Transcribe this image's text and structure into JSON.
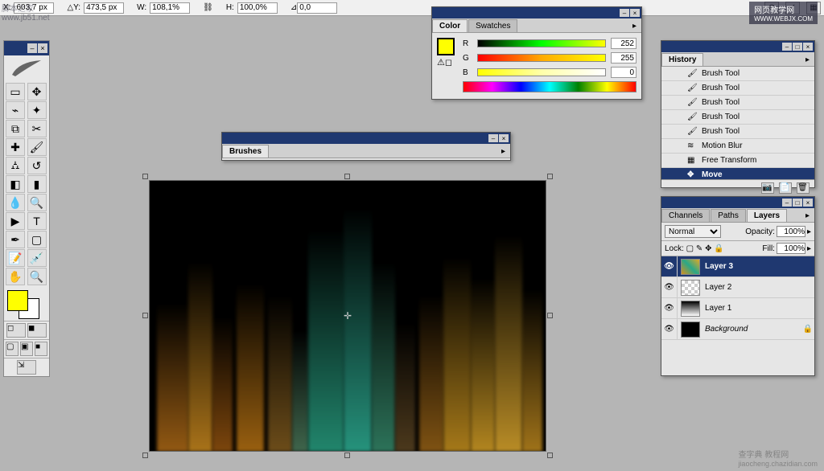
{
  "watermarks": {
    "tl_line1": "脚本之家",
    "tl_line2": "www.jb51.net",
    "tr_main": "网页教学网",
    "tr_sub": "WWW.WEBJX.COM",
    "br_main": "查字典 教程网",
    "br_sub": "jiaocheng.chazidian.com"
  },
  "options_bar": {
    "x_label": "X:",
    "x_value": "603,7 px",
    "y_label": "Y:",
    "y_value": "473,5 px",
    "w_label": "W:",
    "w_value": "108,1%",
    "h_label": "H:",
    "h_value": "100,0%",
    "angle_value": "0,0"
  },
  "color_panel": {
    "tab_color": "Color",
    "tab_swatches": "Swatches",
    "r_label": "R",
    "r_value": "252",
    "g_label": "G",
    "g_value": "255",
    "b_label": "B",
    "b_value": "0",
    "fg_color": "#ffff00",
    "bg_color": "#ffffff"
  },
  "brushes_panel": {
    "tab": "Brushes"
  },
  "history_panel": {
    "tab": "History",
    "items": [
      {
        "label": "Brush Tool",
        "selected": false
      },
      {
        "label": "Brush Tool",
        "selected": false
      },
      {
        "label": "Brush Tool",
        "selected": false
      },
      {
        "label": "Brush Tool",
        "selected": false
      },
      {
        "label": "Brush Tool",
        "selected": false
      },
      {
        "label": "Motion Blur",
        "selected": false
      },
      {
        "label": "Free Transform",
        "selected": false
      },
      {
        "label": "Move",
        "selected": true
      }
    ]
  },
  "layers_panel": {
    "tab_channels": "Channels",
    "tab_paths": "Paths",
    "tab_layers": "Layers",
    "blend_mode": "Normal",
    "opacity_label": "Opacity:",
    "opacity_value": "100%",
    "lock_label": "Lock:",
    "fill_label": "Fill:",
    "fill_value": "100%",
    "layers": [
      {
        "name": "Layer 3",
        "selected": true,
        "locked": false,
        "thumb": "color"
      },
      {
        "name": "Layer 2",
        "selected": false,
        "locked": false,
        "thumb": "checker"
      },
      {
        "name": "Layer 1",
        "selected": false,
        "locked": false,
        "thumb": "gradient"
      },
      {
        "name": "Background",
        "selected": false,
        "locked": true,
        "thumb": "black"
      }
    ]
  }
}
